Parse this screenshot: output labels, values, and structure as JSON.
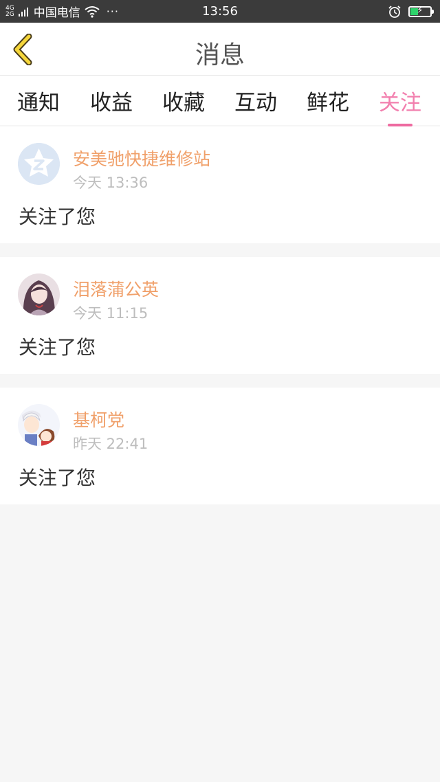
{
  "status_bar": {
    "network_top": "4G",
    "network_bottom": "2G",
    "carrier": "中国电信",
    "dots": "···",
    "time": "13:56",
    "battery_level_pct": 40,
    "battery_color": "#2ed36b"
  },
  "header": {
    "title": "消息",
    "back_icon": "chevron-left-icon"
  },
  "tabs": [
    {
      "label": "通知",
      "active": false
    },
    {
      "label": "收益",
      "active": false
    },
    {
      "label": "收藏",
      "active": false
    },
    {
      "label": "互动",
      "active": false
    },
    {
      "label": "鲜花",
      "active": false
    },
    {
      "label": "关注",
      "active": true
    }
  ],
  "colors": {
    "accent": "#f27fae",
    "username": "#f0a06a",
    "timestamp": "#bdbdbd",
    "background": "#f6f6f6"
  },
  "notifications": [
    {
      "name": "安美驰快捷维修站",
      "time": "今天 13:36",
      "message": "关注了您"
    },
    {
      "name": "泪落蒲公英",
      "time": "今天 11:15",
      "message": "关注了您"
    },
    {
      "name": "基柯党",
      "time": "昨天 22:41",
      "message": "关注了您"
    }
  ]
}
